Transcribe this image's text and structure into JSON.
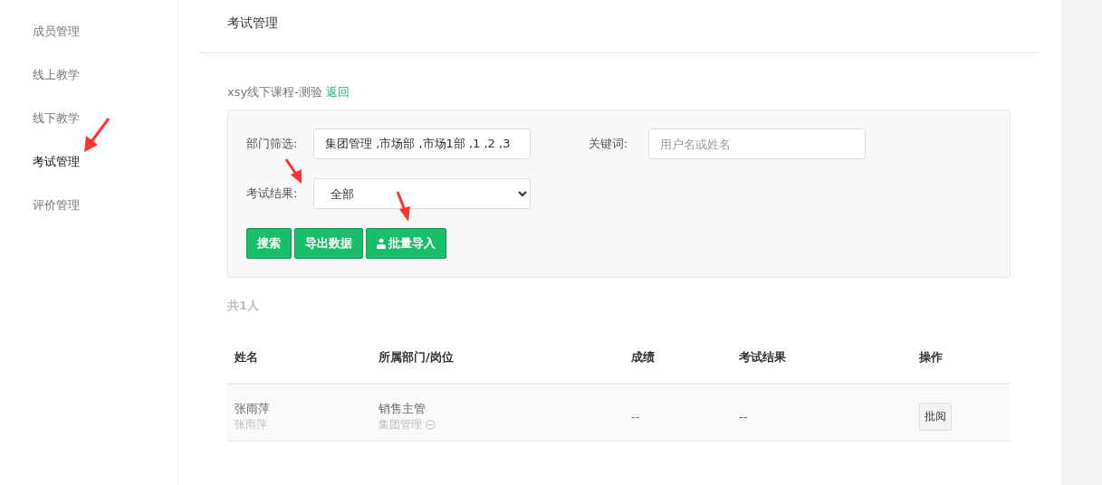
{
  "sidebar": {
    "items": [
      {
        "label": "成员管理",
        "selected": false
      },
      {
        "label": "线上教学",
        "selected": false
      },
      {
        "label": "线下教学",
        "selected": false
      },
      {
        "label": "考试管理",
        "selected": true
      },
      {
        "label": "评价管理",
        "selected": false
      }
    ]
  },
  "header": {
    "title": "考试管理"
  },
  "breadcrumb": {
    "course": "xsy线下课程-测验",
    "back_link": "返回"
  },
  "filters": {
    "department": {
      "label": "部门筛选:",
      "value": "集团管理 ,市场部 ,市场1部 ,1 ,2 ,3"
    },
    "keyword": {
      "label": "关键词:",
      "placeholder": "用户名或姓名"
    },
    "result": {
      "label": "考试结果:",
      "value": "全部"
    },
    "buttons": [
      {
        "label": "搜索",
        "kind": "plain"
      },
      {
        "label": "导出数据",
        "kind": "plain"
      },
      {
        "label": "批量导入",
        "kind": "import"
      }
    ]
  },
  "total": "共1人",
  "table": {
    "columns": [
      "姓名",
      "所属部门/岗位",
      "成绩",
      "考试结果",
      "操作"
    ],
    "rows": [
      {
        "name": "张雨萍",
        "username": "张雨萍",
        "position": "销售主管",
        "department": "集团管理",
        "score": "--",
        "result": "--",
        "action": "批阅"
      }
    ]
  }
}
